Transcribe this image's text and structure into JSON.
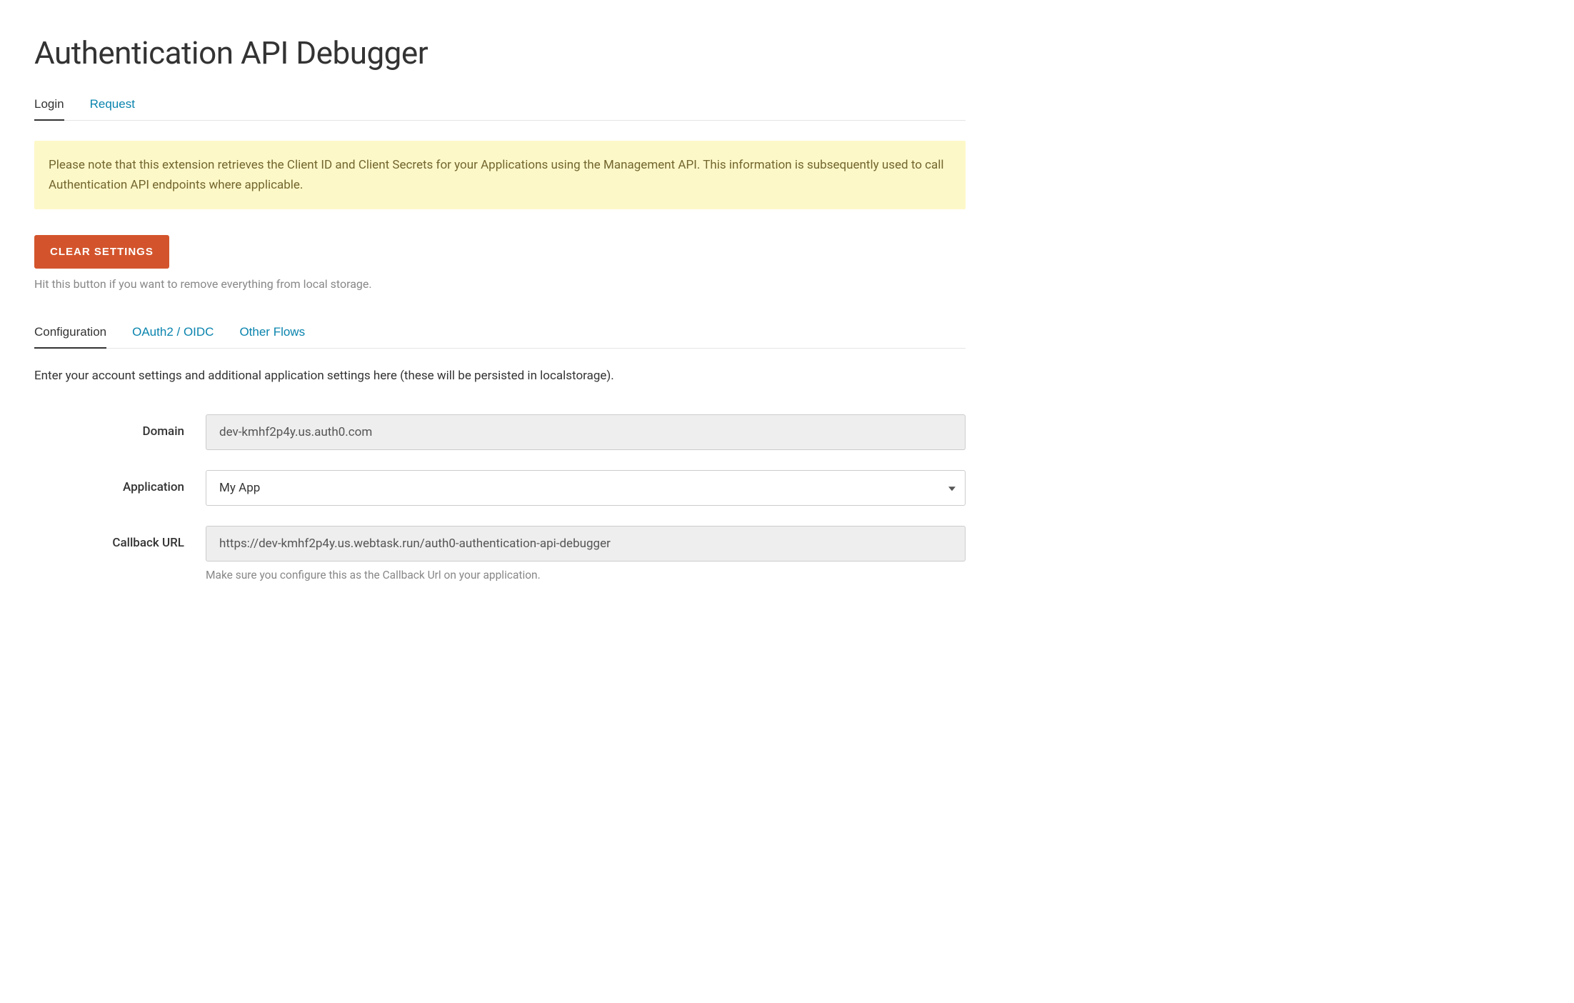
{
  "page": {
    "title": "Authentication API Debugger"
  },
  "tabs": {
    "login": "Login",
    "request": "Request"
  },
  "alert": {
    "text": "Please note that this extension retrieves the Client ID and Client Secrets for your Applications using the Management API. This information is subsequently used to call Authentication API endpoints where applicable."
  },
  "clear": {
    "button": "Clear Settings",
    "helper": "Hit this button if you want to remove everything from local storage."
  },
  "subtabs": {
    "configuration": "Configuration",
    "oauth2_oidc": "OAuth2 / OIDC",
    "other_flows": "Other Flows"
  },
  "configuration": {
    "description": "Enter your account settings and additional application settings here (these will be persisted in localstorage).",
    "domain": {
      "label": "Domain",
      "value": "dev-kmhf2p4y.us.auth0.com"
    },
    "application": {
      "label": "Application",
      "selected": "My App"
    },
    "callback_url": {
      "label": "Callback URL",
      "value": "https://dev-kmhf2p4y.us.webtask.run/auth0-authentication-api-debugger",
      "help": "Make sure you configure this as the Callback Url on your application."
    }
  }
}
